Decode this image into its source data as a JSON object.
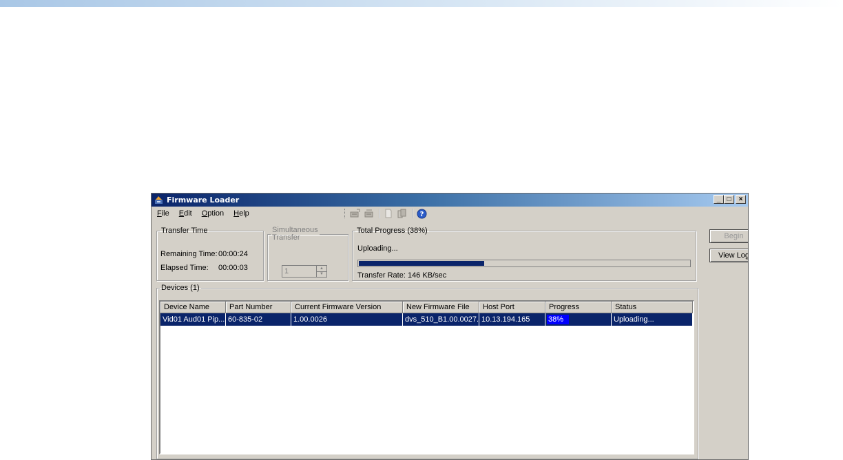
{
  "window": {
    "title": "Firmware Loader",
    "controls": [
      "_",
      "□",
      "×"
    ]
  },
  "menu": [
    "File",
    "Edit",
    "Option",
    "Help"
  ],
  "menu_mnemonics": [
    "F",
    "E",
    "O",
    "H"
  ],
  "toolbar": {
    "icons": [
      "add-device-icon",
      "remove-device-icon",
      "new-document-icon",
      "copy-document-icon",
      "help-icon"
    ]
  },
  "transfer_time": {
    "legend": "Transfer Time",
    "remaining_label": "Remaining Time:",
    "remaining_value": "00:00:24",
    "elapsed_label": "Elapsed Time:",
    "elapsed_value": "00:00:03"
  },
  "simultaneous": {
    "legend_line1": "Simultaneous",
    "legend_line2": "Transfer",
    "value": "1"
  },
  "total_progress": {
    "legend": "Total Progress (38%)",
    "status": "Uploading...",
    "percent": 38,
    "rate_text": "Transfer Rate: 146 KB/sec"
  },
  "buttons": {
    "begin": "Begin",
    "view_log": "View Log"
  },
  "devices": {
    "legend": "Devices (1)",
    "columns": [
      "Device Name",
      "Part Number",
      "Current Firmware Version",
      "New Firmware File",
      "Host Port",
      "Progress",
      "Status"
    ],
    "rows": [
      {
        "device_name": "Vid01 Aud01 Pip...",
        "part_number": "60-835-02",
        "current_version": "1.00.0026",
        "new_file": "dvs_510_B1.00.0027...",
        "host_port": "10.13.194.165",
        "progress_text": "38%",
        "progress": 38,
        "status": "Uploading..."
      }
    ]
  },
  "colors": {
    "selection": "#0a246a",
    "progress_cell": "#0000ff",
    "window_face": "#d4d0c8"
  }
}
